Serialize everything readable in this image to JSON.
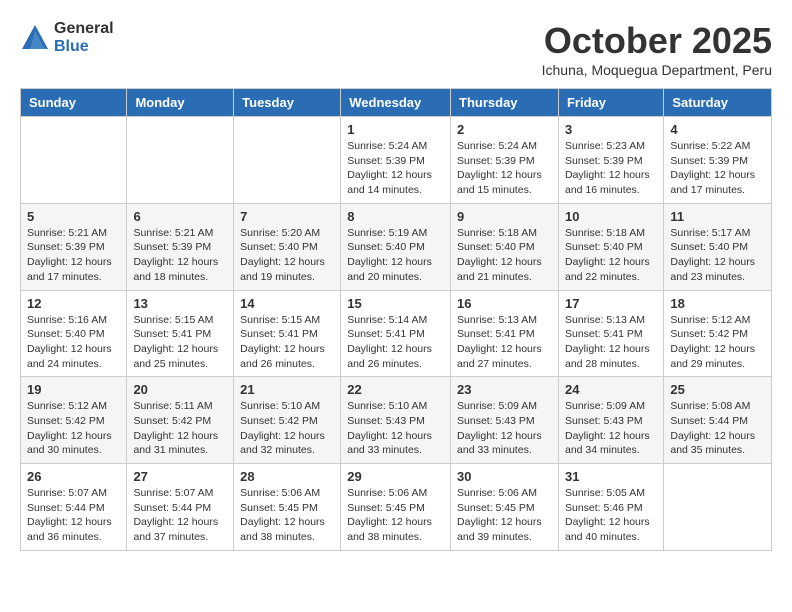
{
  "logo": {
    "general": "General",
    "blue": "Blue"
  },
  "title": {
    "month_year": "October 2025",
    "location": "Ichuna, Moquegua Department, Peru"
  },
  "days_of_week": [
    "Sunday",
    "Monday",
    "Tuesday",
    "Wednesday",
    "Thursday",
    "Friday",
    "Saturday"
  ],
  "weeks": [
    [
      {
        "day": "",
        "info": ""
      },
      {
        "day": "",
        "info": ""
      },
      {
        "day": "",
        "info": ""
      },
      {
        "day": "1",
        "info": "Sunrise: 5:24 AM\nSunset: 5:39 PM\nDaylight: 12 hours and 14 minutes."
      },
      {
        "day": "2",
        "info": "Sunrise: 5:24 AM\nSunset: 5:39 PM\nDaylight: 12 hours and 15 minutes."
      },
      {
        "day": "3",
        "info": "Sunrise: 5:23 AM\nSunset: 5:39 PM\nDaylight: 12 hours and 16 minutes."
      },
      {
        "day": "4",
        "info": "Sunrise: 5:22 AM\nSunset: 5:39 PM\nDaylight: 12 hours and 17 minutes."
      }
    ],
    [
      {
        "day": "5",
        "info": "Sunrise: 5:21 AM\nSunset: 5:39 PM\nDaylight: 12 hours and 17 minutes."
      },
      {
        "day": "6",
        "info": "Sunrise: 5:21 AM\nSunset: 5:39 PM\nDaylight: 12 hours and 18 minutes."
      },
      {
        "day": "7",
        "info": "Sunrise: 5:20 AM\nSunset: 5:40 PM\nDaylight: 12 hours and 19 minutes."
      },
      {
        "day": "8",
        "info": "Sunrise: 5:19 AM\nSunset: 5:40 PM\nDaylight: 12 hours and 20 minutes."
      },
      {
        "day": "9",
        "info": "Sunrise: 5:18 AM\nSunset: 5:40 PM\nDaylight: 12 hours and 21 minutes."
      },
      {
        "day": "10",
        "info": "Sunrise: 5:18 AM\nSunset: 5:40 PM\nDaylight: 12 hours and 22 minutes."
      },
      {
        "day": "11",
        "info": "Sunrise: 5:17 AM\nSunset: 5:40 PM\nDaylight: 12 hours and 23 minutes."
      }
    ],
    [
      {
        "day": "12",
        "info": "Sunrise: 5:16 AM\nSunset: 5:40 PM\nDaylight: 12 hours and 24 minutes."
      },
      {
        "day": "13",
        "info": "Sunrise: 5:15 AM\nSunset: 5:41 PM\nDaylight: 12 hours and 25 minutes."
      },
      {
        "day": "14",
        "info": "Sunrise: 5:15 AM\nSunset: 5:41 PM\nDaylight: 12 hours and 26 minutes."
      },
      {
        "day": "15",
        "info": "Sunrise: 5:14 AM\nSunset: 5:41 PM\nDaylight: 12 hours and 26 minutes."
      },
      {
        "day": "16",
        "info": "Sunrise: 5:13 AM\nSunset: 5:41 PM\nDaylight: 12 hours and 27 minutes."
      },
      {
        "day": "17",
        "info": "Sunrise: 5:13 AM\nSunset: 5:41 PM\nDaylight: 12 hours and 28 minutes."
      },
      {
        "day": "18",
        "info": "Sunrise: 5:12 AM\nSunset: 5:42 PM\nDaylight: 12 hours and 29 minutes."
      }
    ],
    [
      {
        "day": "19",
        "info": "Sunrise: 5:12 AM\nSunset: 5:42 PM\nDaylight: 12 hours and 30 minutes."
      },
      {
        "day": "20",
        "info": "Sunrise: 5:11 AM\nSunset: 5:42 PM\nDaylight: 12 hours and 31 minutes."
      },
      {
        "day": "21",
        "info": "Sunrise: 5:10 AM\nSunset: 5:42 PM\nDaylight: 12 hours and 32 minutes."
      },
      {
        "day": "22",
        "info": "Sunrise: 5:10 AM\nSunset: 5:43 PM\nDaylight: 12 hours and 33 minutes."
      },
      {
        "day": "23",
        "info": "Sunrise: 5:09 AM\nSunset: 5:43 PM\nDaylight: 12 hours and 33 minutes."
      },
      {
        "day": "24",
        "info": "Sunrise: 5:09 AM\nSunset: 5:43 PM\nDaylight: 12 hours and 34 minutes."
      },
      {
        "day": "25",
        "info": "Sunrise: 5:08 AM\nSunset: 5:44 PM\nDaylight: 12 hours and 35 minutes."
      }
    ],
    [
      {
        "day": "26",
        "info": "Sunrise: 5:07 AM\nSunset: 5:44 PM\nDaylight: 12 hours and 36 minutes."
      },
      {
        "day": "27",
        "info": "Sunrise: 5:07 AM\nSunset: 5:44 PM\nDaylight: 12 hours and 37 minutes."
      },
      {
        "day": "28",
        "info": "Sunrise: 5:06 AM\nSunset: 5:45 PM\nDaylight: 12 hours and 38 minutes."
      },
      {
        "day": "29",
        "info": "Sunrise: 5:06 AM\nSunset: 5:45 PM\nDaylight: 12 hours and 38 minutes."
      },
      {
        "day": "30",
        "info": "Sunrise: 5:06 AM\nSunset: 5:45 PM\nDaylight: 12 hours and 39 minutes."
      },
      {
        "day": "31",
        "info": "Sunrise: 5:05 AM\nSunset: 5:46 PM\nDaylight: 12 hours and 40 minutes."
      },
      {
        "day": "",
        "info": ""
      }
    ]
  ]
}
